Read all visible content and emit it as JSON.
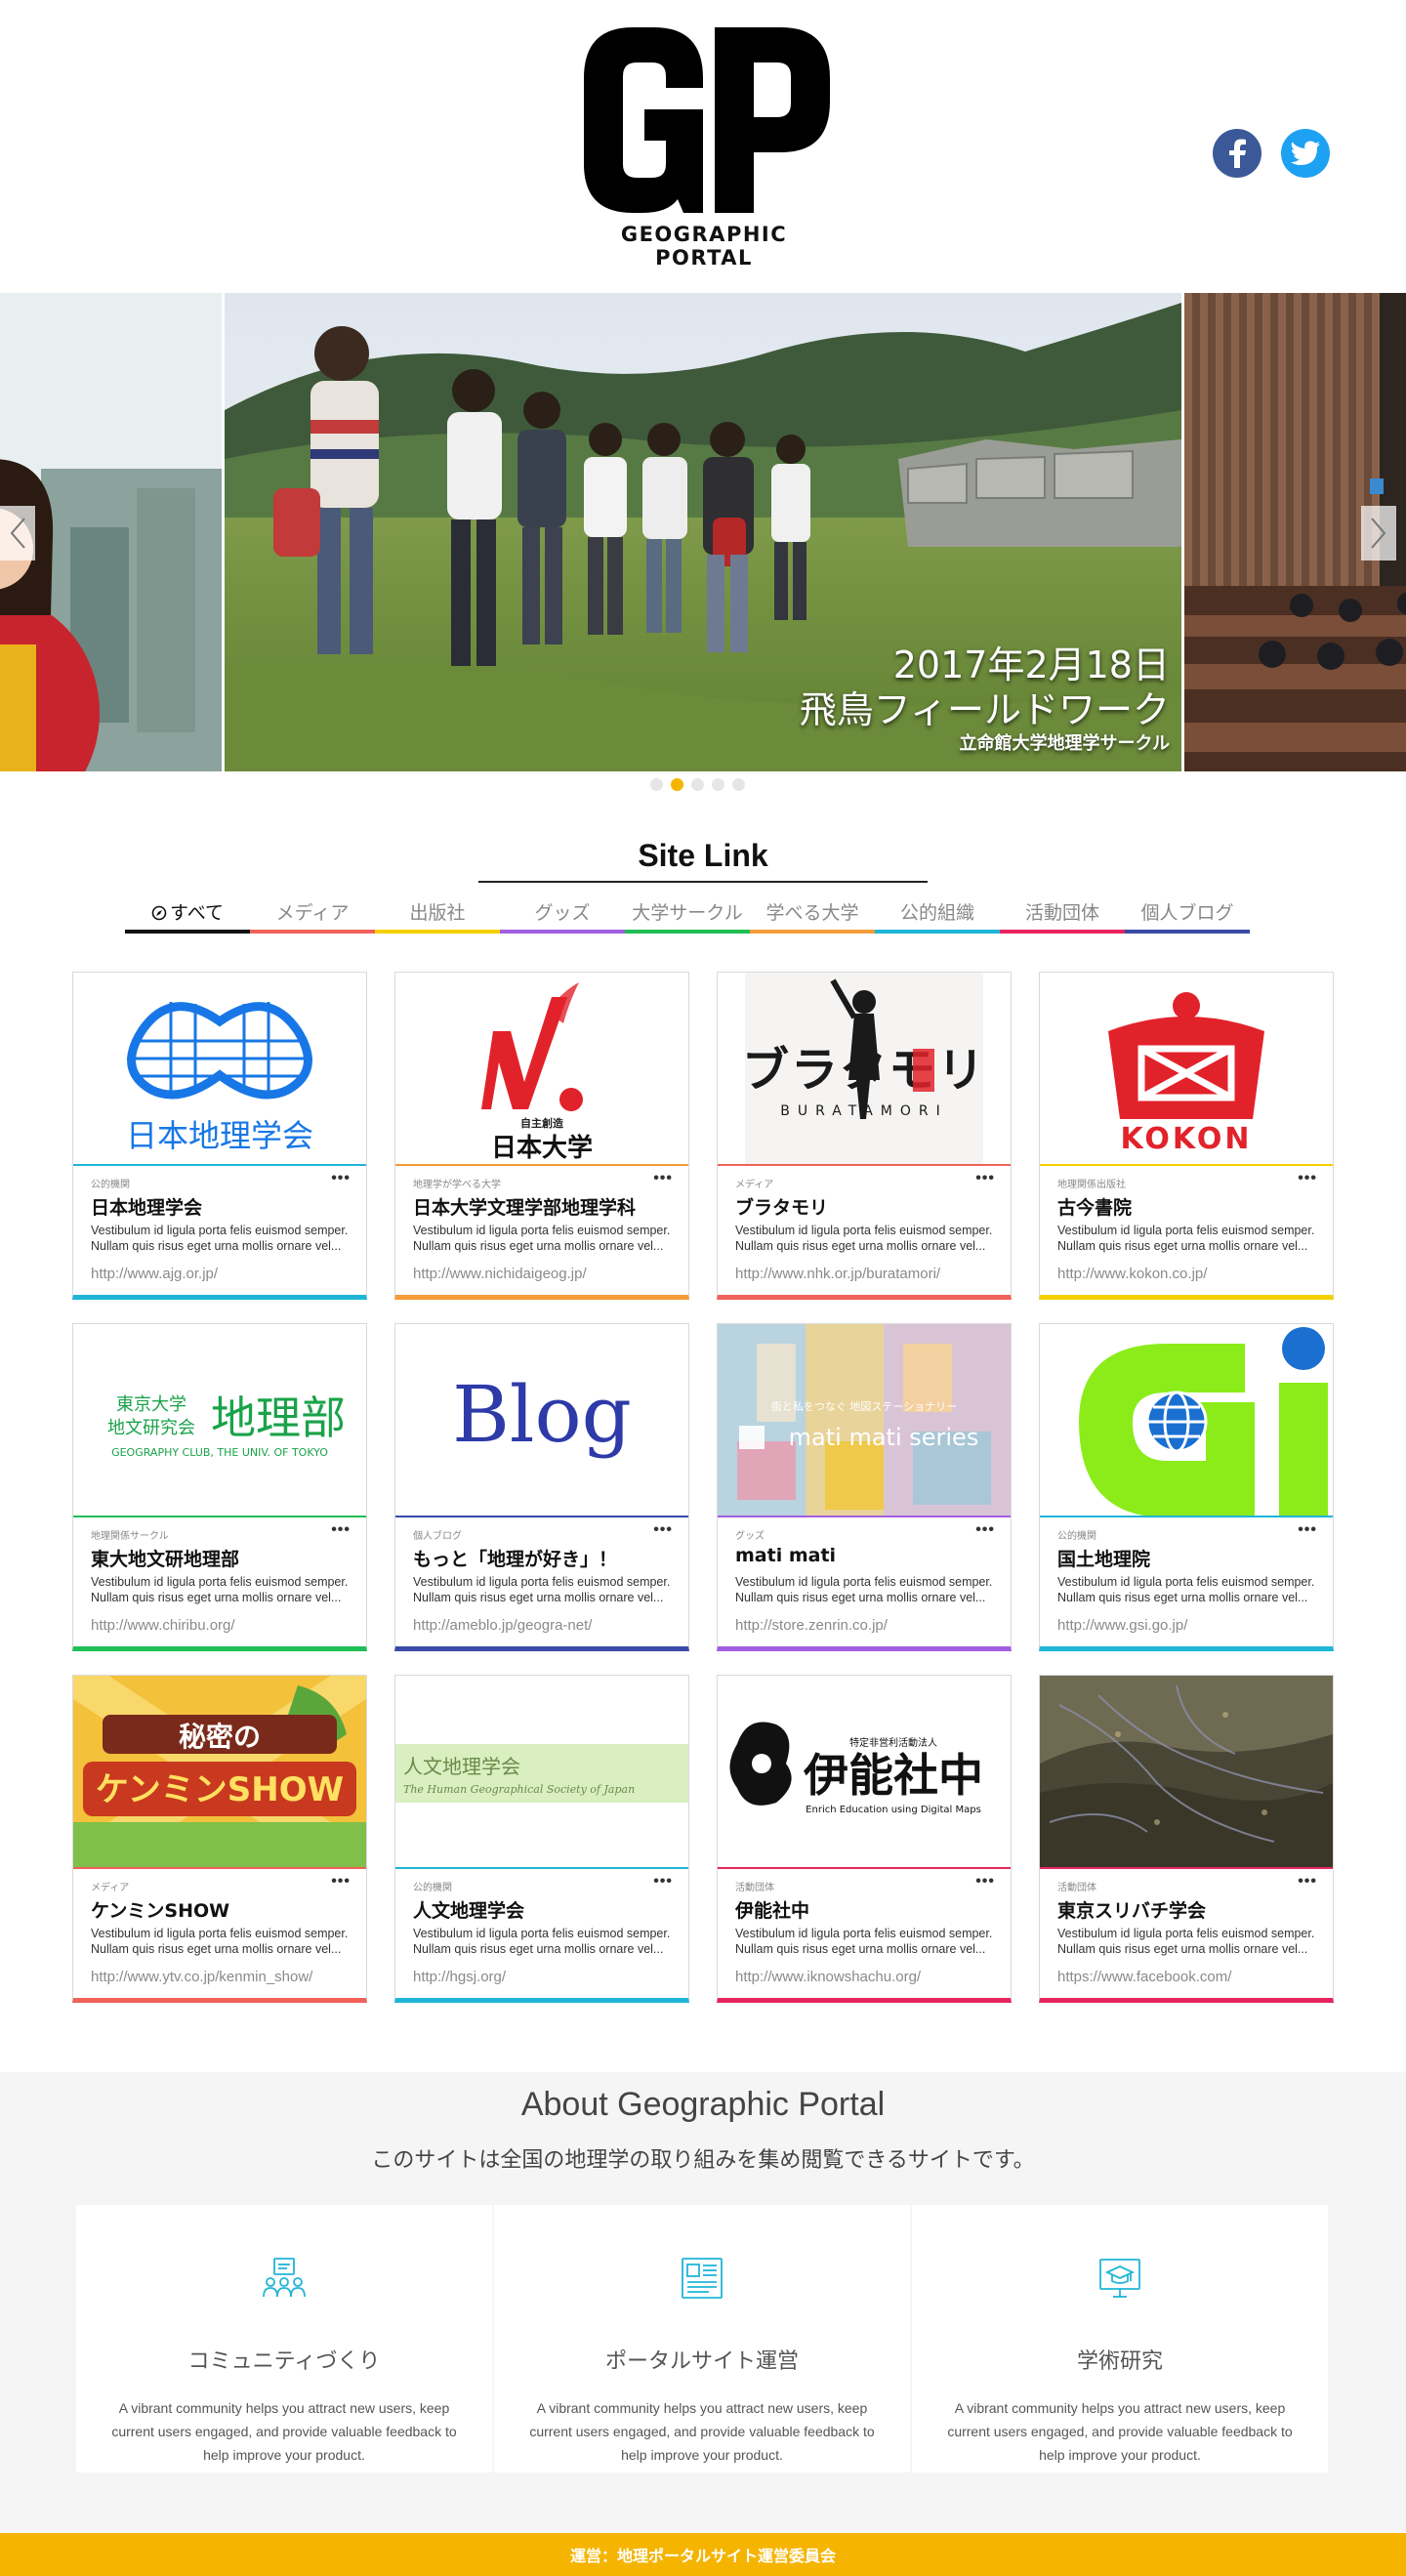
{
  "header": {
    "logo_mark": "GP",
    "logo_text": "GEOGRAPHIC PORTAL",
    "social": [
      {
        "name": "facebook",
        "icon": "facebook-icon",
        "color": "#3b5998"
      },
      {
        "name": "twitter",
        "icon": "twitter-icon",
        "color": "#1da1f2"
      }
    ]
  },
  "slider": {
    "caption": {
      "date": "2017年2月18日",
      "title": "飛鳥フィールドワーク",
      "org": "立命館大学地理学サークル"
    },
    "prev_icon": "chevron-left-icon",
    "next_icon": "chevron-right-icon",
    "dots_count": 5,
    "active_dot": 1,
    "accent_color": "#f5b400"
  },
  "site_link": {
    "title": "Site Link",
    "tabs": [
      {
        "label": "すべて",
        "color": "#111111",
        "icon": "compass-icon",
        "active": true
      },
      {
        "label": "メディア",
        "color": "#f0625a"
      },
      {
        "label": "出版社",
        "color": "#f5d000"
      },
      {
        "label": "グッズ",
        "color": "#a25ee0"
      },
      {
        "label": "大学サークル",
        "color": "#1fbf55"
      },
      {
        "label": "学べる大学",
        "color": "#f59b3a"
      },
      {
        "label": "公的組織",
        "color": "#20b5d8"
      },
      {
        "label": "活動団体",
        "color": "#e8245f"
      },
      {
        "label": "個人ブログ",
        "color": "#3a4aa8"
      }
    ],
    "cards": [
      {
        "category": "公的機関",
        "title": "日本地理学会",
        "desc": "Vestibulum id ligula porta felis euismod semper. Nullam quis risus eget urna mollis ornare vel...",
        "url": "http://www.ajg.or.jp/",
        "color": "#20b5d8",
        "thumb": "ajg-logo",
        "thumb_text": "日本地理学会"
      },
      {
        "category": "地理学が学べる大学",
        "title": "日本大学文理学部地理学科",
        "desc": "Vestibulum id ligula porta felis euismod semper. Nullam quis risus eget urna mollis ornare vel...",
        "url": "http://www.nichidaigeog.jp/",
        "color": "#f59b3a",
        "thumb": "nihon-univ-logo",
        "thumb_text": "日本大学",
        "thumb_sub": "自主創造"
      },
      {
        "category": "メディア",
        "title": "ブラタモリ",
        "desc": "Vestibulum id ligula porta felis euismod semper. Nullam quis risus eget urna mollis ornare vel...",
        "url": "http://www.nhk.or.jp/buratamori/",
        "color": "#f0625a",
        "thumb": "buratamori-logo",
        "thumb_text": "ブラタモリ",
        "thumb_sub": "BURATAMORI"
      },
      {
        "category": "地理関係出版社",
        "title": "古今書院",
        "desc": "Vestibulum id ligula porta felis euismod semper. Nullam quis risus eget urna mollis ornare vel...",
        "url": "http://www.kokon.co.jp/",
        "color": "#f5d000",
        "thumb": "kokon-logo",
        "thumb_text": "KOKON"
      },
      {
        "category": "地理関係サークル",
        "title": "東大地文研地理部",
        "desc": "Vestibulum id ligula porta felis euismod semper. Nullam quis risus eget urna mollis ornare vel...",
        "url": "http://www.chiribu.org/",
        "color": "#1fbf55",
        "thumb": "chiribu-logo",
        "thumb_text": "地理部",
        "thumb_sub1": "東京大学",
        "thumb_sub2": "地文研究会",
        "thumb_sub3": "GEOGRAPHY CLUB, THE UNIV. OF TOKYO"
      },
      {
        "category": "個人ブログ",
        "title": "もっと「地理が好き」！",
        "desc": "Vestibulum id ligula porta felis euismod semper. Nullam quis risus eget urna mollis ornare vel...",
        "url": "http://ameblo.jp/geogra-net/",
        "color": "#3a4aa8",
        "thumb": "blog-logo",
        "thumb_text": "Blog"
      },
      {
        "category": "グッズ",
        "title": "mati mati",
        "desc": "Vestibulum id ligula porta felis euismod semper. Nullam quis risus eget urna mollis ornare vel...",
        "url": "http://store.zenrin.co.jp/",
        "color": "#a25ee0",
        "thumb": "matimati-photo",
        "thumb_text": "mati mati series",
        "thumb_sub": "街と私をつなぐ 地図ステーショナリー"
      },
      {
        "category": "公的機関",
        "title": "国土地理院",
        "desc": "Vestibulum id ligula porta felis euismod semper. Nullam quis risus eget urna mollis ornare vel...",
        "url": "http://www.gsi.go.jp/",
        "color": "#20b5d8",
        "thumb": "gsi-logo"
      },
      {
        "category": "メディア",
        "title": "ケンミンSHOW",
        "desc": "Vestibulum id ligula porta felis euismod semper. Nullam quis risus eget urna mollis ornare vel...",
        "url": "http://www.ytv.co.jp/kenmin_show/",
        "color": "#f0625a",
        "thumb": "kenmin-logo",
        "thumb_text": "ケンミンSHOW",
        "thumb_sub": "秘密の"
      },
      {
        "category": "公的機関",
        "title": "人文地理学会",
        "desc": "Vestibulum id ligula porta felis euismod semper. Nullam quis risus eget urna mollis ornare vel...",
        "url": "http://hgsj.org/",
        "color": "#20b5d8",
        "thumb": "hgsj-logo",
        "thumb_text": "人文地理学会",
        "thumb_sub": "The Human Geographical Society of Japan"
      },
      {
        "category": "活動団体",
        "title": "伊能社中",
        "desc": "Vestibulum id ligula porta felis euismod semper. Nullam quis risus eget urna mollis ornare vel...",
        "url": "http://www.iknowshachu.org/",
        "color": "#e8245f",
        "thumb": "iknow-logo",
        "thumb_text": "伊能社中",
        "thumb_sub": "Enrich Education using Digital Maps",
        "thumb_sub2": "特定非営利活動法人"
      },
      {
        "category": "活動団体",
        "title": "東京スリバチ学会",
        "desc": "Vestibulum id ligula porta felis euismod semper. Nullam quis risus eget urna mollis ornare vel...",
        "url": "https://www.facebook.com/",
        "color": "#e8245f",
        "thumb": "suribachi-map"
      }
    ],
    "more_icon": "more-dots-icon",
    "more_label": "•••"
  },
  "about": {
    "title": "About Geographic Portal",
    "subtitle": "このサイトは全国の地理学の取り組みを集め閲覧できるサイトです。",
    "features": [
      {
        "icon": "community-icon",
        "title": "コミュニティづくり",
        "text": "A vibrant community helps you attract new users, keep current users engaged, and provide valuable feedback to help improve your product."
      },
      {
        "icon": "document-icon",
        "title": "ポータルサイト運営",
        "text": "A vibrant community helps you attract new users, keep current users engaged, and provide valuable feedback to help improve your product."
      },
      {
        "icon": "graduation-icon",
        "title": "学術研究",
        "text": "A vibrant community helps you attract new users, keep current users engaged, and provide valuable feedback to help improve your product."
      }
    ],
    "icon_color": "#20b5d8"
  },
  "footer": {
    "text": "運営：地理ポータルサイト運営委員会",
    "color": "#f5b400"
  }
}
